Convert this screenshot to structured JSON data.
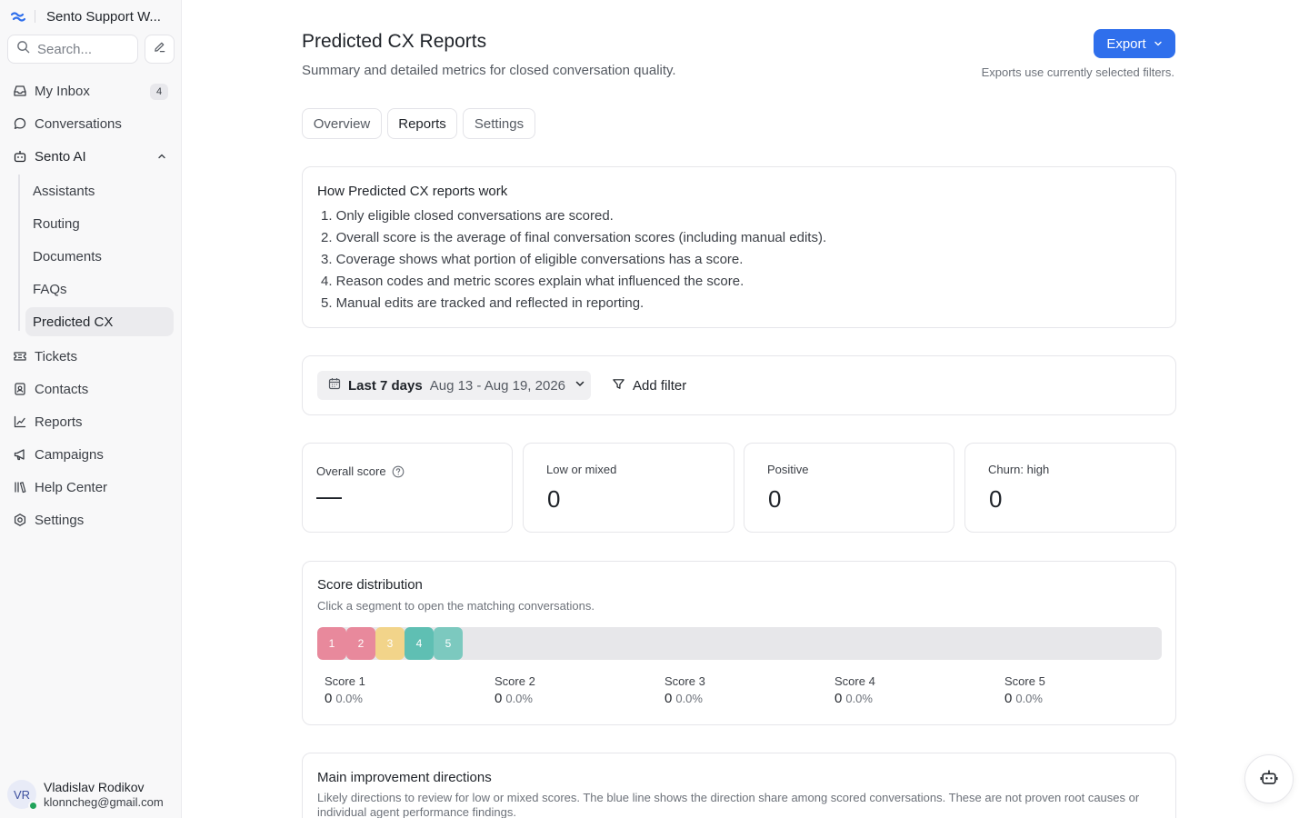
{
  "sidebar": {
    "workspace_name": "Sento Support W...",
    "search_placeholder": "Search...",
    "nav": [
      {
        "label": "My Inbox",
        "badge": "4",
        "icon": "inbox-icon"
      },
      {
        "label": "Conversations",
        "icon": "chat-bubble-icon"
      },
      {
        "label": "Sento AI",
        "icon": "robot-icon",
        "expanded": true
      },
      {
        "label": "Tickets",
        "icon": "ticket-icon"
      },
      {
        "label": "Contacts",
        "icon": "contact-card-icon"
      },
      {
        "label": "Reports",
        "icon": "line-chart-icon"
      },
      {
        "label": "Campaigns",
        "icon": "megaphone-icon"
      },
      {
        "label": "Help Center",
        "icon": "library-icon"
      },
      {
        "label": "Settings",
        "icon": "gear-icon"
      }
    ],
    "sento_ai_items": [
      {
        "label": "Assistants"
      },
      {
        "label": "Routing"
      },
      {
        "label": "Documents"
      },
      {
        "label": "FAQs"
      },
      {
        "label": "Predicted CX",
        "active": true
      }
    ],
    "user": {
      "initials": "VR",
      "name": "Vladislav Rodikov",
      "email": "klonncheg@gmail.com",
      "status_color": "#21a35a"
    }
  },
  "header": {
    "title": "Predicted CX Reports",
    "subtitle": "Summary and detailed metrics for closed conversation quality.",
    "export_label": "Export",
    "export_note": "Exports use currently selected filters.",
    "accent_color": "#2f6fec"
  },
  "tabs": [
    {
      "label": "Overview"
    },
    {
      "label": "Reports",
      "active": true
    },
    {
      "label": "Settings"
    }
  ],
  "how": {
    "title": "How Predicted CX reports work",
    "items": [
      "1. Only eligible closed conversations are scored.",
      "2. Overall score is the average of final conversation scores (including manual edits).",
      "3. Coverage shows what portion of eligible conversations has a score.",
      "4. Reason codes and metric scores explain what influenced the score.",
      "5. Manual edits are tracked and reflected in reporting."
    ]
  },
  "filters": {
    "date_label": "Last 7 days",
    "date_range": "Aug 13 - Aug 19, 2026",
    "add_filter": "Add filter"
  },
  "stats": {
    "overall_label": "Overall score",
    "overall_value": "—",
    "low_label": "Low or mixed",
    "low_value": "0",
    "positive_label": "Positive",
    "positive_value": "0",
    "churn_label": "Churn: high",
    "churn_value": "0"
  },
  "distribution": {
    "title": "Score distribution",
    "subtitle": "Click a segment to open the matching conversations.",
    "segments": [
      {
        "label": "1",
        "color": "#e8899c"
      },
      {
        "label": "2",
        "color": "#e8899c"
      },
      {
        "label": "3",
        "color": "#f2d48a"
      },
      {
        "label": "4",
        "color": "#5fbfb3"
      },
      {
        "label": "5",
        "color": "#7cc9bf"
      }
    ],
    "scores": [
      {
        "label": "Score 1",
        "count": "0",
        "pct": "0.0%"
      },
      {
        "label": "Score 2",
        "count": "0",
        "pct": "0.0%"
      },
      {
        "label": "Score 3",
        "count": "0",
        "pct": "0.0%"
      },
      {
        "label": "Score 4",
        "count": "0",
        "pct": "0.0%"
      },
      {
        "label": "Score 5",
        "count": "0",
        "pct": "0.0%"
      }
    ]
  },
  "improvement": {
    "title": "Main improvement directions",
    "subtitle": "Likely directions to review for low or mixed scores. The blue line shows the direction share among scored conversations. These are not proven root causes or individual agent performance findings."
  }
}
